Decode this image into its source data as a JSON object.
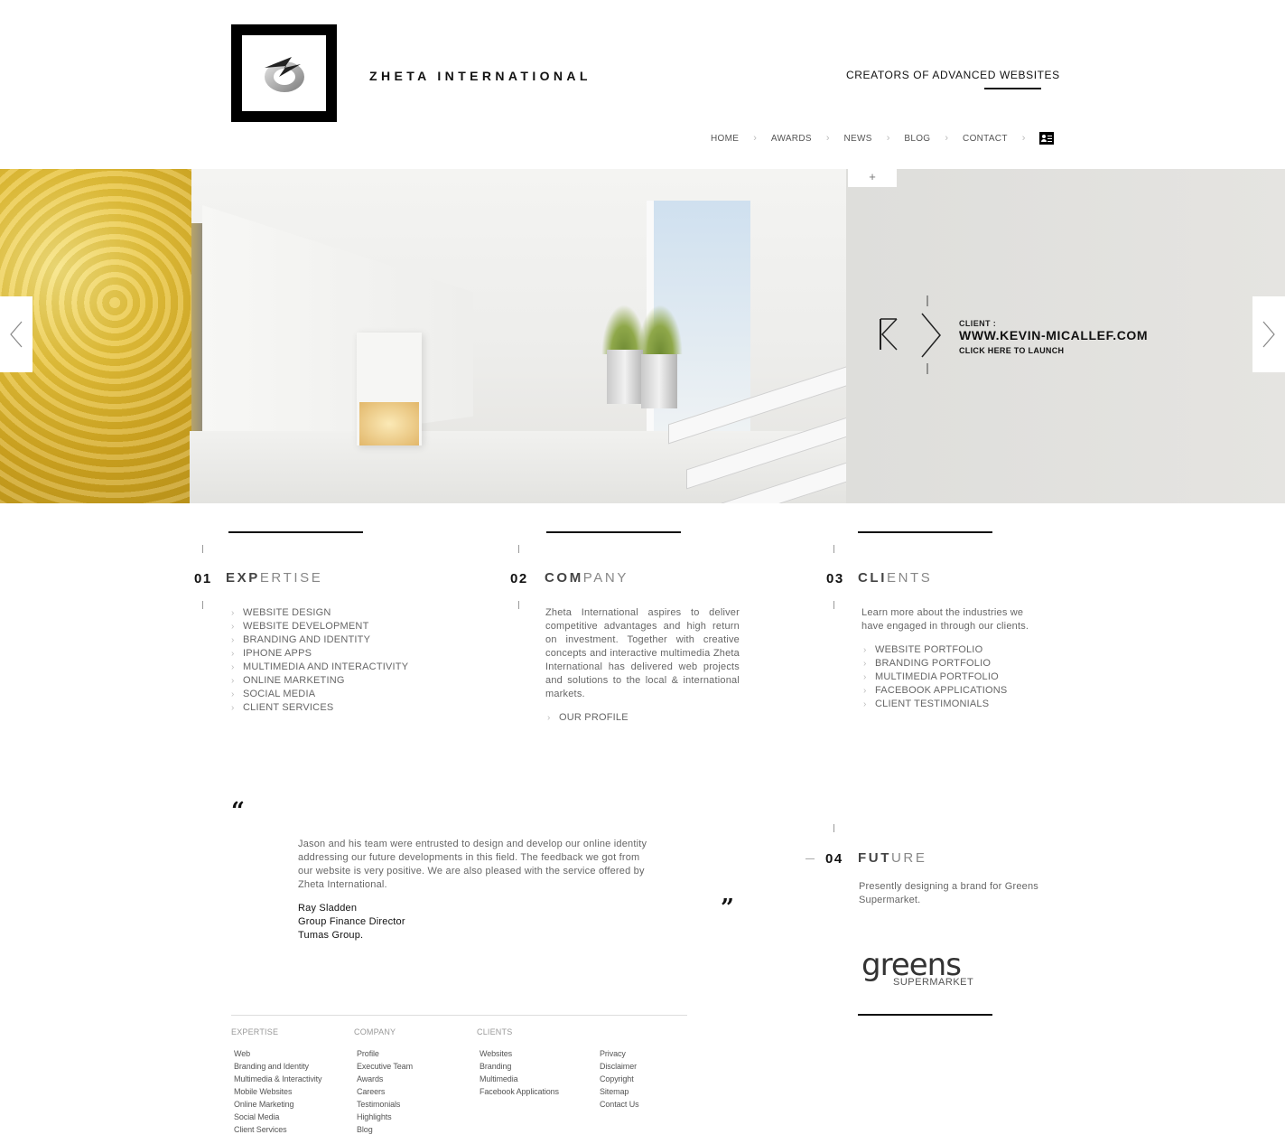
{
  "header": {
    "brand": "ZHETA INTERNATIONAL",
    "tagline": "CREATORS OF ADVANCED WEBSITES"
  },
  "nav": {
    "items": [
      "HOME",
      "AWARDS",
      "NEWS",
      "BLOG",
      "CONTACT"
    ],
    "separator": "›"
  },
  "hero": {
    "panel_tab": "+",
    "client_label": "CLIENT :",
    "client_url": "WWW.KEVIN-MICALLEF.COM",
    "client_cta": "CLICK HERE TO LAUNCH"
  },
  "columns": {
    "expertise": {
      "number": "01",
      "title_strong": "EXP",
      "title_rest": "ERTISE",
      "items": [
        "WEBSITE DESIGN",
        "WEBSITE DEVELOPMENT",
        "BRANDING AND IDENTITY",
        "IPHONE APPS",
        "MULTIMEDIA AND INTERACTIVITY",
        "ONLINE MARKETING",
        "SOCIAL MEDIA",
        "CLIENT SERVICES"
      ]
    },
    "company": {
      "number": "02",
      "title_strong": "COM",
      "title_rest": "PANY",
      "text": "Zheta International aspires to deliver competitive advantages and high return on investment. Together with creative concepts and interactive multimedia Zheta International has delivered web projects and solutions to the local & international markets.",
      "link": "OUR PROFILE"
    },
    "clients": {
      "number": "03",
      "title_strong": "CLI",
      "title_rest": "ENTS",
      "intro": "Learn more about the industries we have engaged in through our clients.",
      "items": [
        "WEBSITE PORTFOLIO",
        "BRANDING PORTFOLIO",
        "MULTIMEDIA PORTFOLIO",
        "FACEBOOK APPLICATIONS",
        "CLIENT TESTIMONIALS"
      ]
    },
    "future": {
      "number": "04",
      "title_strong": "FUT",
      "title_rest": "URE",
      "text": "Presently designing a brand for Greens Supermarket.",
      "logo_main": "greens",
      "logo_sub": "SUPERMARKET"
    }
  },
  "testimonial": {
    "open_quote": "“",
    "close_quote": "”",
    "text": "Jason and his team were entrusted to design and develop our online identity addressing our future developments in this field. The feedback we got from our website is very positive. We are also pleased with the service offered by Zheta International.",
    "author_name": "Ray Sladden",
    "author_role": "Group Finance Director",
    "author_company": "Tumas Group."
  },
  "footer": {
    "expertise": {
      "heading": "EXPERTISE",
      "items": [
        "Web",
        "Branding and Identity",
        "Multimedia & Interactivity",
        "Mobile Websites",
        "Online Marketing",
        "Social Media",
        "Client Services"
      ]
    },
    "company": {
      "heading": "COMPANY",
      "items": [
        "Profile",
        "Executive Team",
        "Awards",
        "Careers",
        "Testimonials",
        "Highlights",
        "Blog"
      ]
    },
    "clients": {
      "heading": "CLIENTS",
      "items": [
        "Websites",
        "Branding",
        "Multimedia",
        "Facebook Applications"
      ]
    },
    "legal": {
      "items": [
        "Privacy",
        "Disclaimer",
        "Copyright",
        "Sitemap",
        "Contact Us"
      ]
    }
  },
  "colors": {
    "text": "#555555",
    "heading": "#111111",
    "accent_bar": "#111111"
  }
}
